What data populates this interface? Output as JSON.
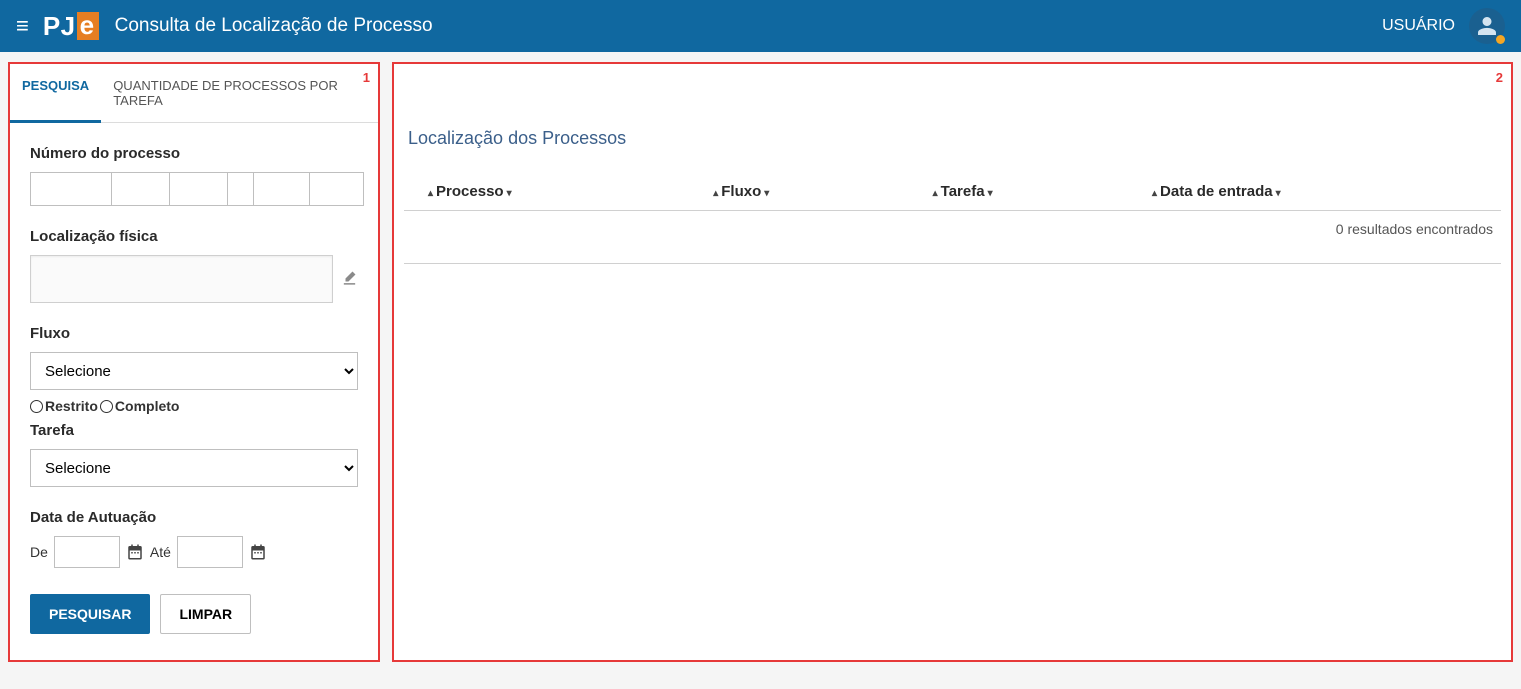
{
  "header": {
    "title": "Consulta de Localização de Processo",
    "user_label": "USUÁRIO",
    "logo_p": "PJ",
    "logo_e": "e"
  },
  "annotations": {
    "left": "1",
    "right": "2"
  },
  "tabs": {
    "search": "PESQUISA",
    "count": "QUANTIDADE DE PROCESSOS POR TAREFA"
  },
  "form": {
    "numero_label": "Número do processo",
    "localizacao_label": "Localização física",
    "fluxo_label": "Fluxo",
    "fluxo_selected": "Selecione",
    "radio_restrito": "Restrito",
    "radio_completo": "Completo",
    "tarefa_label": "Tarefa",
    "tarefa_selected": "Selecione",
    "data_autuacao_label": "Data de Autuação",
    "de": "De",
    "ate": "Até",
    "btn_search": "PESQUISAR",
    "btn_clear": "LIMPAR"
  },
  "results": {
    "title": "Localização dos Processos",
    "columns": {
      "processo": "Processo",
      "fluxo": "Fluxo",
      "tarefa": "Tarefa",
      "data": "Data de entrada"
    },
    "footer": "0 resultados encontrados"
  }
}
